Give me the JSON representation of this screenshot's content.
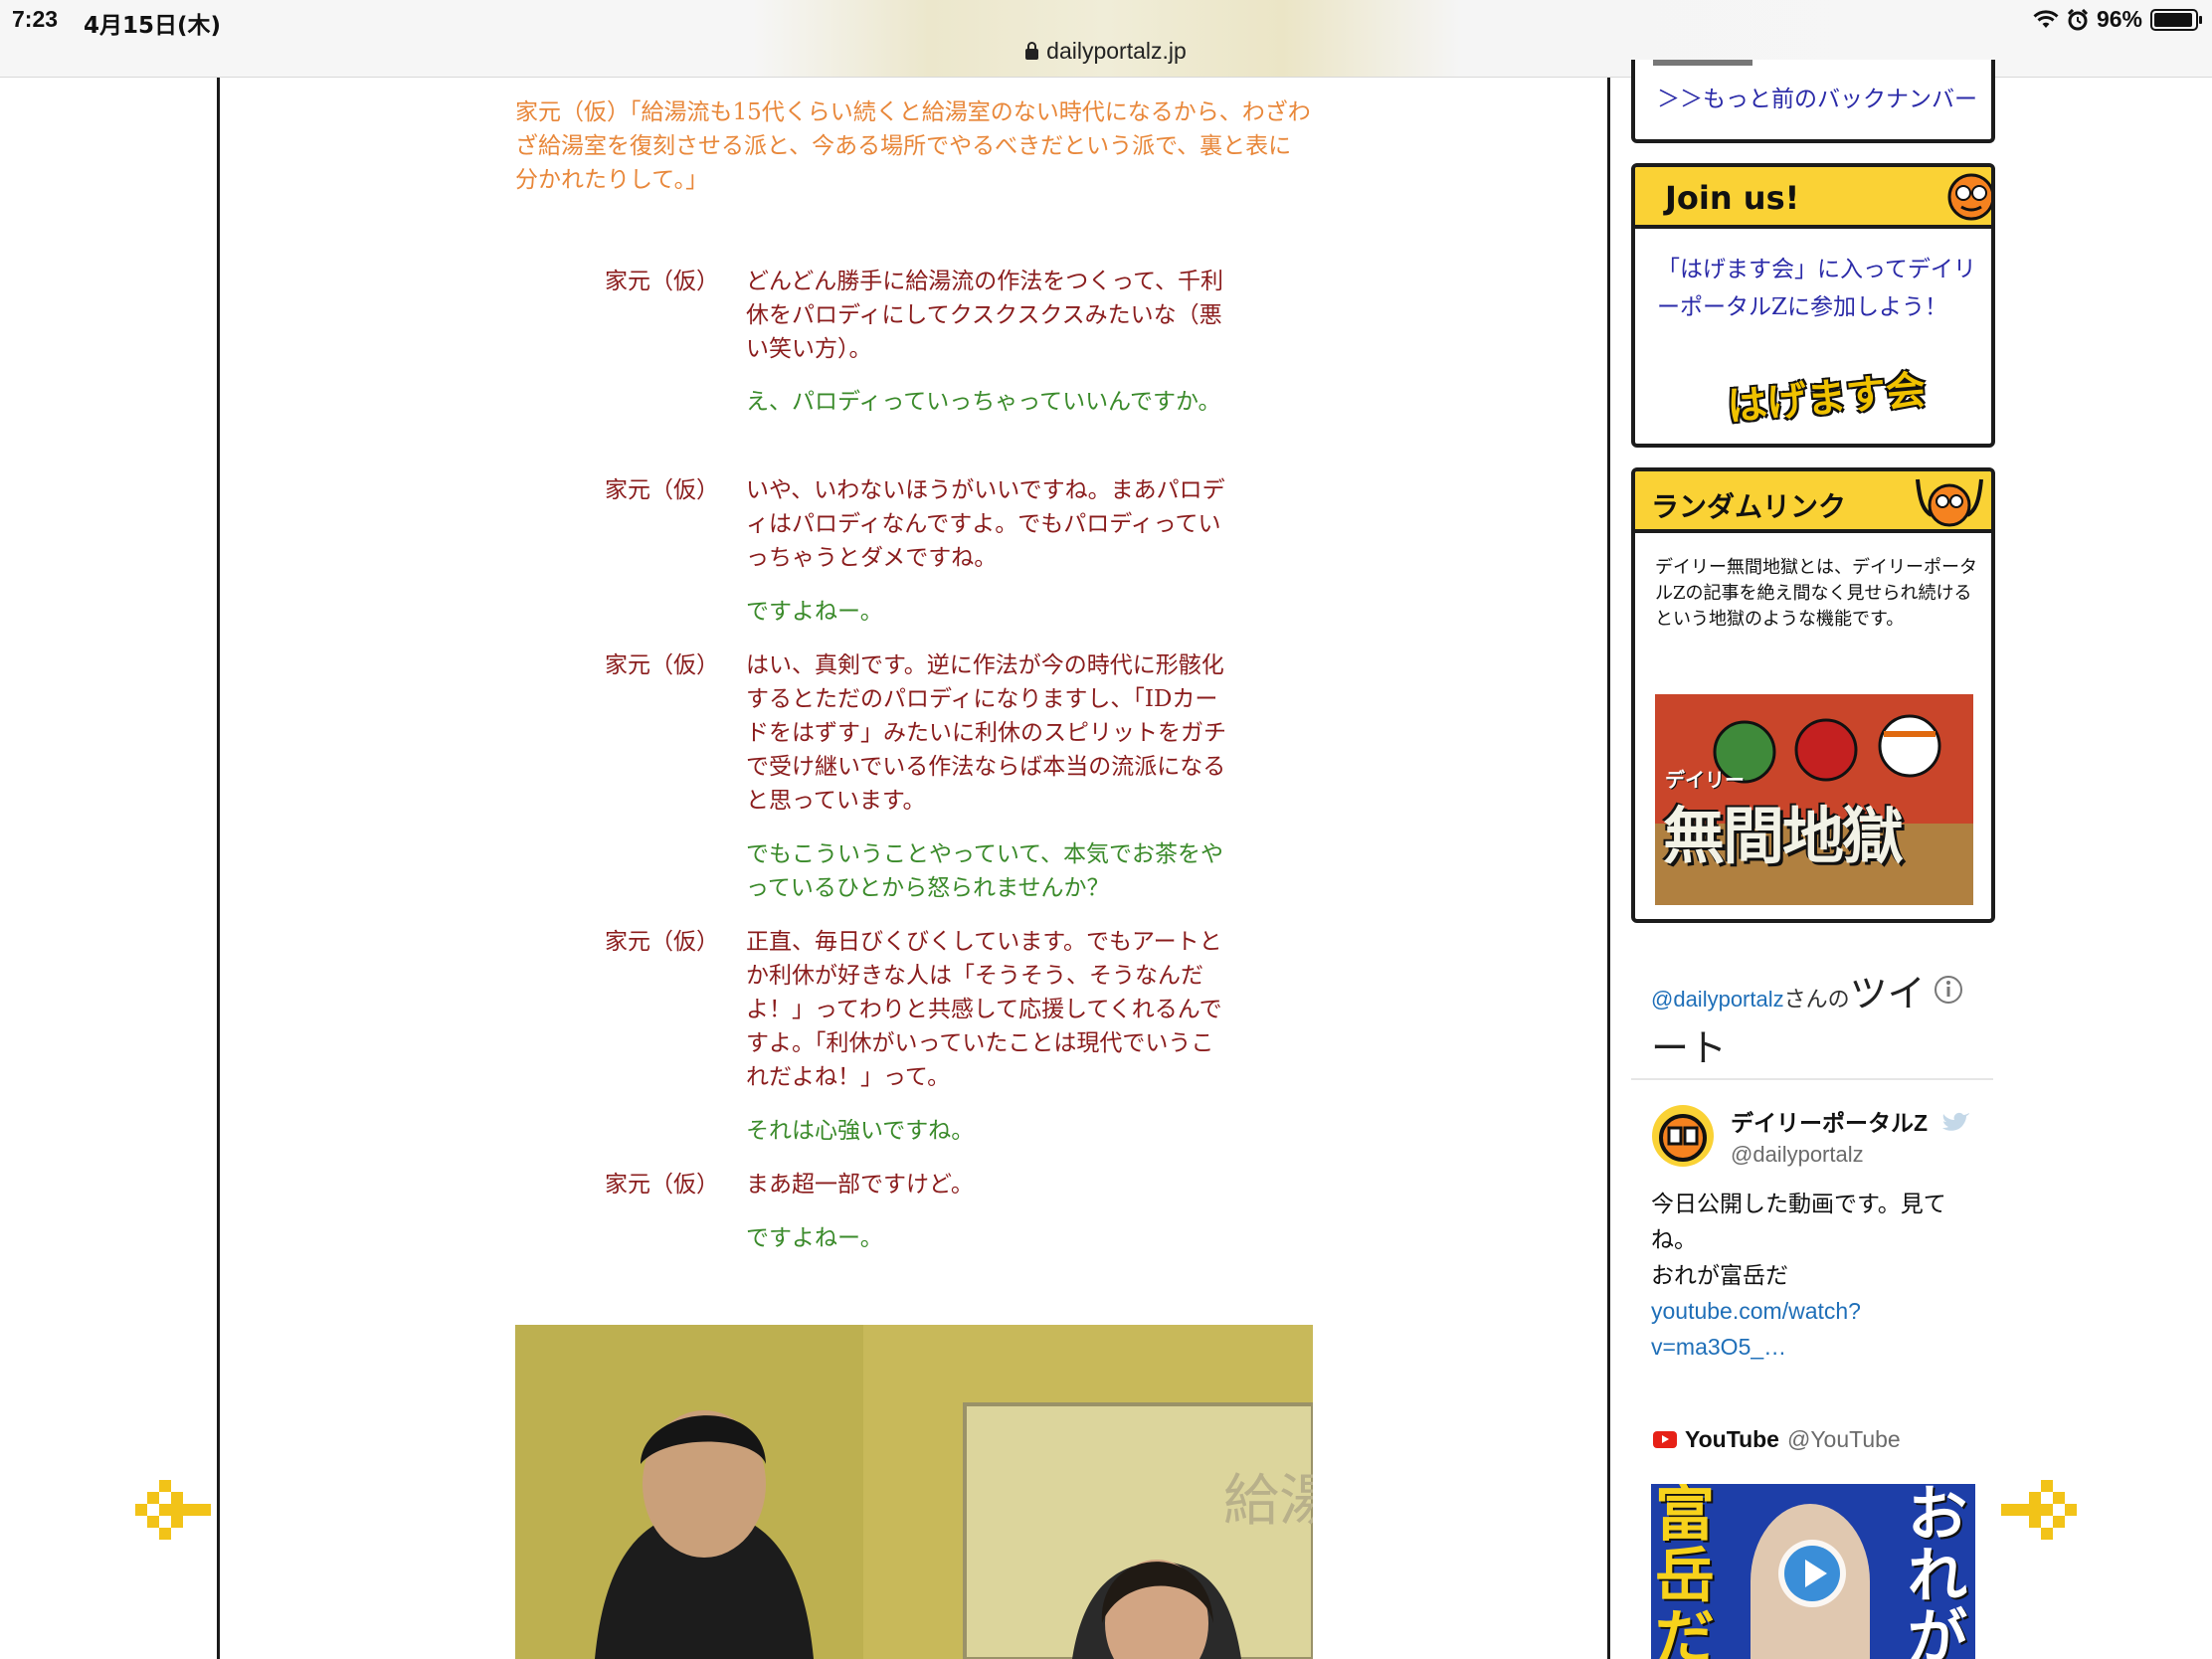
{
  "status_bar": {
    "time": "7:23",
    "date": "4月15日(木)",
    "battery": "96%",
    "battery_level": 0.96
  },
  "browser": {
    "url": "dailyportalz.jp"
  },
  "article": {
    "orange_para": "家元（仮）「給湯流も15代くらい続くと給湯室のない時代になるから、わざわざ給湯室を復刻させる派と、今ある場所でやるべきだという派で、裏と表に分かれたりして。」",
    "speaker": "家元（仮）",
    "lines": [
      {
        "type": "red",
        "text": "どんどん勝手に給湯流の作法をつくって、千利休をパロディにしてクスクスクスみたいな（悪い笑い方）。"
      },
      {
        "type": "green",
        "text": "え、パロディっていっちゃっていいんですか。"
      },
      {
        "type": "red",
        "text": "いや、いわないほうがいいですね。まあパロディはパロディなんですよ。でもパロディっていっちゃうとダメですね。"
      },
      {
        "type": "green",
        "text": "ですよねー。"
      },
      {
        "type": "red",
        "text": "はい、真剣です。逆に作法が今の時代に形骸化するとただのパロディになりますし、「IDカードをはずす」みたいに利休のスピリットをガチで受け継いでいる作法ならば本当の流派になると思っています。"
      },
      {
        "type": "green",
        "text": "でもこういうことやっていて、本気でお茶をやっているひとから怒られませんか？"
      },
      {
        "type": "red",
        "text": "正直、毎日びくびくしています。でもアートとか利休が好きな人は「そうそう、そうなんだよ！」ってわりと共感して応援してくれるんですよ。「利休がいっていたことは現代でいうこれだよね！」って。"
      },
      {
        "type": "green",
        "text": "それは心強いですね。"
      },
      {
        "type": "red",
        "text": "まあ超一部ですけど。"
      },
      {
        "type": "green",
        "text": "ですよねー。"
      }
    ],
    "photo_board_text": "給湯"
  },
  "sidebar": {
    "back_link": "＞＞もっと前のバックナンバー",
    "join": {
      "title": "Join us!",
      "text": "「はげます会」に入ってデイリーポータルZに参加しよう！",
      "logo_text": "はげます会"
    },
    "random": {
      "title": "ランダムリンク",
      "text": "デイリー無間地獄とは、デイリーポータルZの記事を絶え間なく見せられ続けるという地獄のような機能です。",
      "banner_small": "デイリー",
      "banner_big": "無間地獄"
    },
    "twitter": {
      "handle_link": "@dailyportalz",
      "suffix": "さんの",
      "big_1": "ツイ",
      "big_2": "ート",
      "account_name": "デイリーポータルZ",
      "account_handle": "@dailyportalz",
      "tweet_line1": "今日公開した動画です。見てね。",
      "tweet_line2": "おれが富岳だ",
      "tweet_link1": "youtube.com/watch?",
      "tweet_link2": "v=ma3O5_…",
      "yt_name": "YouTube",
      "yt_handle": "@YouTube",
      "thumb_left": "富岳だ",
      "thumb_right": "おれが"
    }
  },
  "colors": {
    "accent_yellow": "#fad235",
    "speaker_red": "#8a1c1c",
    "reply_green": "#3a8a2a",
    "orange": "#e8873a",
    "link_blue": "#2a2aa8"
  }
}
